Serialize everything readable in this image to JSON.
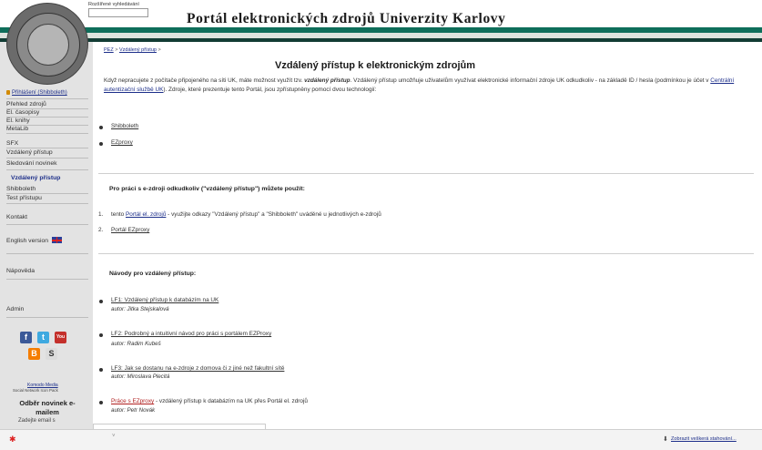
{
  "header": {
    "title": "Portál elektronických zdrojů Univerzity Karlovy",
    "advanced_search": "Rozšířené vyhledávání"
  },
  "sidebar": {
    "login": "Přihlášení (Shibboleth)",
    "items": [
      "Přehled zdrojů",
      "El. časopisy",
      "El. knihy",
      "MetaLib",
      "SFX",
      "Vzdálený přístup",
      "Sledování novinek"
    ],
    "group_title": "Vzdálený přístup",
    "group_items": [
      "Shibboleth",
      "Test přístupu"
    ],
    "contact": "Kontakt",
    "english": "English version",
    "help": "Nápověda",
    "admin": "Admin",
    "social_icons": [
      "facebook-icon",
      "twitter-icon",
      "youtube-icon",
      "blogger-icon",
      "skype-icon"
    ],
    "social_glyphs": {
      "facebook": "f",
      "twitter": "t",
      "youtube": "You",
      "blogger": "B",
      "skype": "S"
    },
    "komodo_link": "Komodo Media",
    "komodo_sub": "Social Network Icon Pack",
    "news_title": "Odběr novinek e-mailem",
    "news_cut": "Zadejte email s"
  },
  "main": {
    "breadcrumb_home": "PEZ",
    "breadcrumb_sep": " > ",
    "breadcrumb_current": "Vzdálený přístup",
    "breadcrumb_end": " >",
    "heading": "Vzdálený přístup k elektronickým zdrojům",
    "intro_1": "Když nepracujete z počítače připojeného na síti UK, máte možnost využít tzv. ",
    "intro_bold": "vzdálený přístup",
    "intro_2": ". Vzdálený přístup umožňuje uživatelům využívat elektronické informační zdroje UK odkudkoliv - na základě ID / hesla (podmínkou je účet v ",
    "intro_link": "Centrální autentizační službě UK",
    "intro_3": "). Zdroje, které prezentuje tento Portál, jsou zpřístupněny pomocí dvou technologií:",
    "technologies": [
      "Shibboleth",
      "EZproxy"
    ],
    "section1_heading": "Pro práci s e-zdroji odkudkoliv (\"vzdálený přístup\") můžete použít:",
    "option1_num": "1.",
    "option1_pre": "tento ",
    "option1_link": "Portál el. zdrojů",
    "option1_post": " - využijte odkazy \"Vzdálený přístup\" a \"Shibboleth\" uváděné u jednotlivých e-zdrojů",
    "option2_num": "2.",
    "option2_link": "Portál EZproxy",
    "section2_heading": "Návody pro vzdálený přístup:",
    "guides": [
      {
        "title": "LF1: Vzdálený přístup k databázím na UK",
        "author": "autor: Jitka Stejskalová"
      },
      {
        "title": "LF2: Podrobný a intuitivní návod pro práci s portálem EZProxy",
        "author": "autor: Radim Kubeš"
      },
      {
        "title": "LF3: Jak se dostanu na e-zdroje z domova či z jiné než fakultní sítě",
        "author": "autor: Miroslava Plecitá"
      }
    ],
    "guide4_link": "Práce s EZproxy",
    "guide4_rest": " - vzdálený přístup k databázím na UK přes Portál el. zdrojů",
    "guide4_author": "autor: Petr Novák"
  },
  "download_bar": {
    "divider": "˅",
    "show_all": "Zobrazit veškerá stahování..."
  },
  "colors": {
    "accent_green": "#0e6e5a",
    "dark_green": "#123c34",
    "link_blue": "#1d2f8a",
    "sidebar_bg": "#e3e3e3"
  }
}
